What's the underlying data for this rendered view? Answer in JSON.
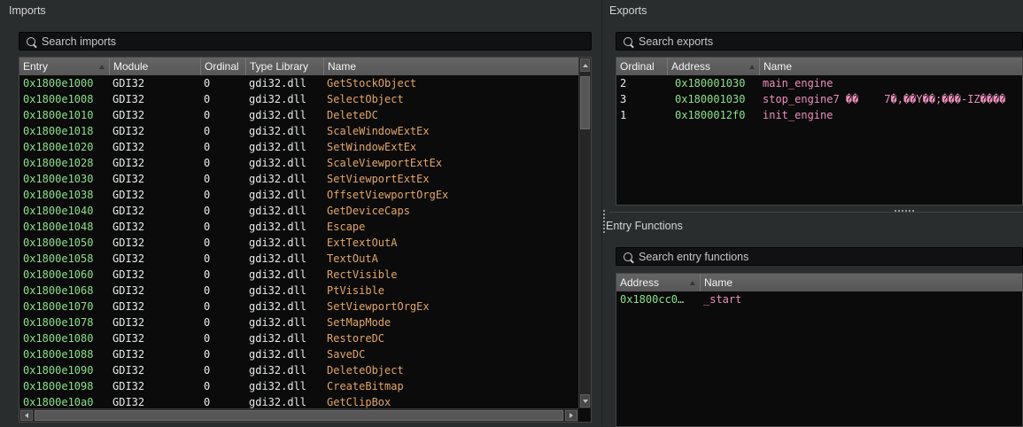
{
  "colors": {
    "background": "#2a2d2e",
    "table_background": "#0b0b0b",
    "header_background": "#5c5c5c",
    "address_text": "#8be08b",
    "plain_text": "#e7ece7",
    "import_name_text": "#e2a56a",
    "export_name_text": "#ec8fbd",
    "title_text": "#d4d4d4"
  },
  "icons": {
    "search": "magnifier",
    "sort_ascending": "triangle-up",
    "scroll_arrows": "triangle up/down/left/right"
  },
  "imports_panel": {
    "title": "Imports",
    "search_placeholder": "Search imports",
    "columns": [
      "Entry",
      "Module",
      "Ordinal",
      "Type Library",
      "Name"
    ],
    "sorted_by": "Entry ascending",
    "rows": [
      {
        "entry": "0x1800e1000",
        "module": "GDI32",
        "ordinal": "0",
        "type_library": "gdi32.dll",
        "name": "GetStockObject"
      },
      {
        "entry": "0x1800e1008",
        "module": "GDI32",
        "ordinal": "0",
        "type_library": "gdi32.dll",
        "name": "SelectObject"
      },
      {
        "entry": "0x1800e1010",
        "module": "GDI32",
        "ordinal": "0",
        "type_library": "gdi32.dll",
        "name": "DeleteDC"
      },
      {
        "entry": "0x1800e1018",
        "module": "GDI32",
        "ordinal": "0",
        "type_library": "gdi32.dll",
        "name": "ScaleWindowExtEx"
      },
      {
        "entry": "0x1800e1020",
        "module": "GDI32",
        "ordinal": "0",
        "type_library": "gdi32.dll",
        "name": "SetWindowExtEx"
      },
      {
        "entry": "0x1800e1028",
        "module": "GDI32",
        "ordinal": "0",
        "type_library": "gdi32.dll",
        "name": "ScaleViewportExtEx"
      },
      {
        "entry": "0x1800e1030",
        "module": "GDI32",
        "ordinal": "0",
        "type_library": "gdi32.dll",
        "name": "SetViewportExtEx"
      },
      {
        "entry": "0x1800e1038",
        "module": "GDI32",
        "ordinal": "0",
        "type_library": "gdi32.dll",
        "name": "OffsetViewportOrgEx"
      },
      {
        "entry": "0x1800e1040",
        "module": "GDI32",
        "ordinal": "0",
        "type_library": "gdi32.dll",
        "name": "GetDeviceCaps"
      },
      {
        "entry": "0x1800e1048",
        "module": "GDI32",
        "ordinal": "0",
        "type_library": "gdi32.dll",
        "name": "Escape"
      },
      {
        "entry": "0x1800e1050",
        "module": "GDI32",
        "ordinal": "0",
        "type_library": "gdi32.dll",
        "name": "ExtTextOutA"
      },
      {
        "entry": "0x1800e1058",
        "module": "GDI32",
        "ordinal": "0",
        "type_library": "gdi32.dll",
        "name": "TextOutA"
      },
      {
        "entry": "0x1800e1060",
        "module": "GDI32",
        "ordinal": "0",
        "type_library": "gdi32.dll",
        "name": "RectVisible"
      },
      {
        "entry": "0x1800e1068",
        "module": "GDI32",
        "ordinal": "0",
        "type_library": "gdi32.dll",
        "name": "PtVisible"
      },
      {
        "entry": "0x1800e1070",
        "module": "GDI32",
        "ordinal": "0",
        "type_library": "gdi32.dll",
        "name": "SetViewportOrgEx"
      },
      {
        "entry": "0x1800e1078",
        "module": "GDI32",
        "ordinal": "0",
        "type_library": "gdi32.dll",
        "name": "SetMapMode"
      },
      {
        "entry": "0x1800e1080",
        "module": "GDI32",
        "ordinal": "0",
        "type_library": "gdi32.dll",
        "name": "RestoreDC"
      },
      {
        "entry": "0x1800e1088",
        "module": "GDI32",
        "ordinal": "0",
        "type_library": "gdi32.dll",
        "name": "SaveDC"
      },
      {
        "entry": "0x1800e1090",
        "module": "GDI32",
        "ordinal": "0",
        "type_library": "gdi32.dll",
        "name": "DeleteObject"
      },
      {
        "entry": "0x1800e1098",
        "module": "GDI32",
        "ordinal": "0",
        "type_library": "gdi32.dll",
        "name": "CreateBitmap"
      },
      {
        "entry": "0x1800e10a0",
        "module": "GDI32",
        "ordinal": "0",
        "type_library": "gdi32.dll",
        "name": "GetClipBox"
      }
    ]
  },
  "exports_panel": {
    "title": "Exports",
    "search_placeholder": "Search exports",
    "columns": [
      "Ordinal",
      "Address",
      "Name"
    ],
    "sorted_by": "Address ascending",
    "rows": [
      {
        "ordinal": "2",
        "address": "0x180001030",
        "name": "main_engine"
      },
      {
        "ordinal": "3",
        "address": "0x180001030",
        "name": "stop_engine7 ��    7�,��Y��;���-IZ����"
      },
      {
        "ordinal": "1",
        "address": "0x1800012f0",
        "name": "init_engine"
      }
    ]
  },
  "entry_functions_panel": {
    "title": "Entry Functions",
    "search_placeholder": "Search entry functions",
    "columns": [
      "Address",
      "Name"
    ],
    "sorted_by": "Address ascending",
    "rows": [
      {
        "address": "0x1800cc0…",
        "name": "_start"
      }
    ]
  }
}
